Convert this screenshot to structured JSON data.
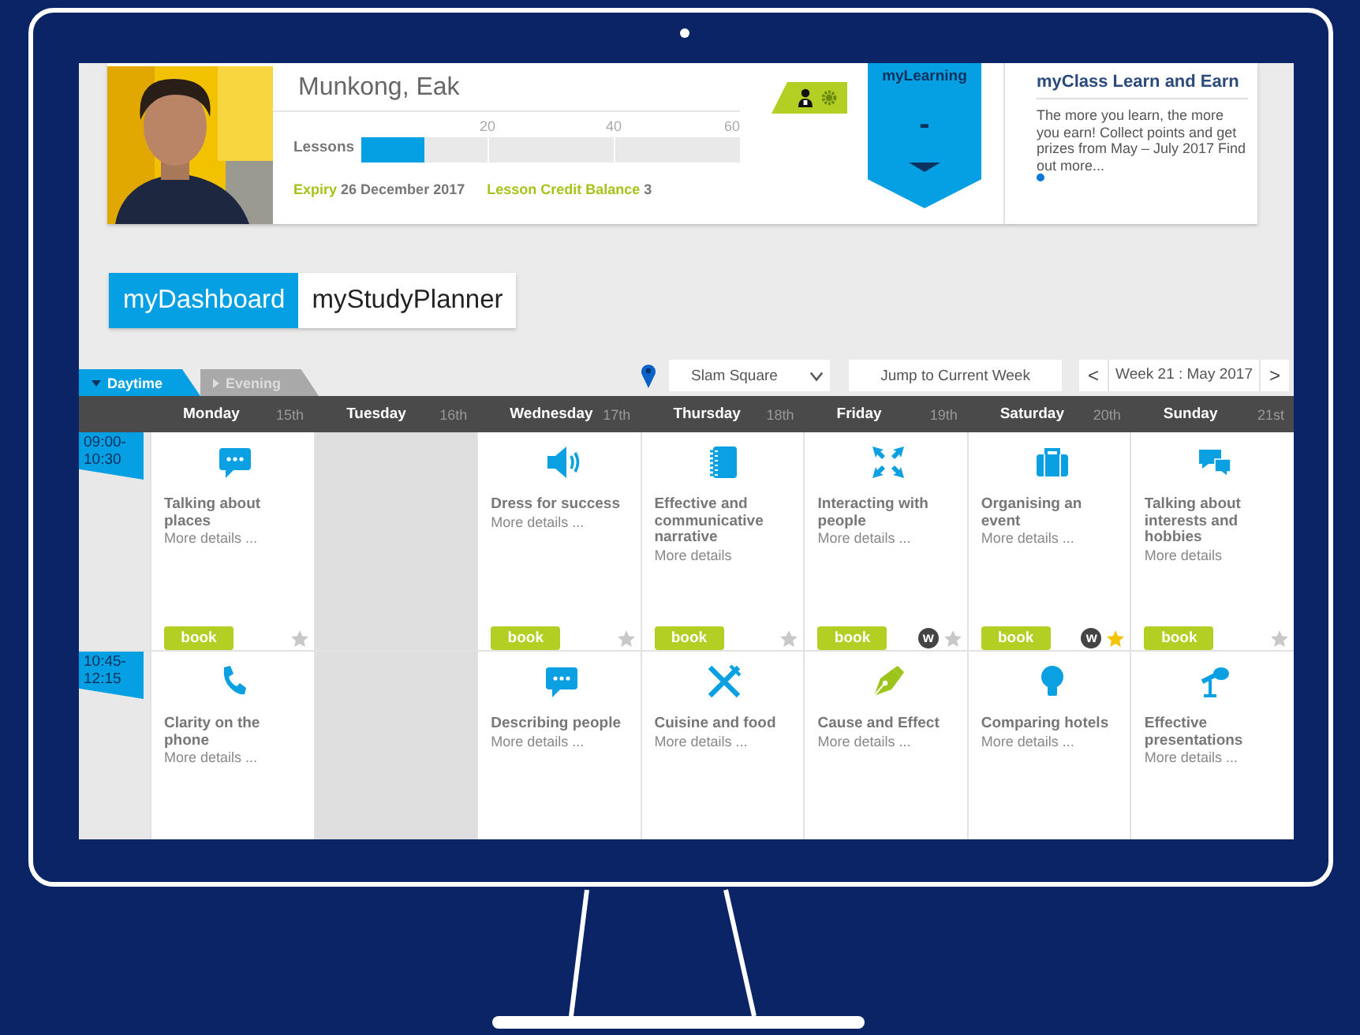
{
  "profile": {
    "name": "Munkong, Eak",
    "lessons_label": "Lessons",
    "ticks": [
      "20",
      "40",
      "60"
    ],
    "level": 0.167,
    "expiry_label": "Expiry",
    "expiry": "26 December 2017",
    "credit_label": "Lesson Credit Balance",
    "credit": "3"
  },
  "my_learning": {
    "title": "myLearning",
    "value": "-"
  },
  "my_class": {
    "title": "myClass Learn and Earn",
    "text": "The more you learn, the more you earn! Collect points and get prizes from May – July 2017 Find out more...",
    "pages": [
      {
        "selected": true
      }
    ]
  },
  "main_tabs": [
    {
      "label": "myDashboard",
      "selected": true
    },
    {
      "label": "myStudyPlanner",
      "selected": false
    }
  ],
  "time_tabs": [
    {
      "label": "Daytime",
      "selected": true
    },
    {
      "label": "Evening",
      "selected": false
    }
  ],
  "toolbar": {
    "location": "Slam Square",
    "jump_button": "Jump to Current Week",
    "prev": "<",
    "week": "Week 21 : May 2017",
    "next": ">"
  },
  "days": [
    {
      "name": "Monday",
      "date": "15th"
    },
    {
      "name": "Tuesday",
      "date": "16th"
    },
    {
      "name": "Wednesday",
      "date": "17th"
    },
    {
      "name": "Thursday",
      "date": "18th"
    },
    {
      "name": "Friday",
      "date": "19th"
    },
    {
      "name": "Saturday",
      "date": "20th"
    },
    {
      "name": "Sunday",
      "date": "21st"
    }
  ],
  "slots": [
    {
      "time": "09:00-10:30",
      "sessions": [
        {
          "kind": "lesson",
          "title": "Talking about places",
          "details": "More details ...",
          "book": "book",
          "starred": false
        },
        {
          "kind": "unavailable"
        },
        {
          "kind": "lesson",
          "title": "Dress for success",
          "details": "More details ...",
          "book": "book",
          "starred": false
        },
        {
          "kind": "lesson",
          "title": "Effective and communicative narrative",
          "details": "More details",
          "book": "book",
          "starred": false
        },
        {
          "kind": "lesson",
          "title": "Interacting with people",
          "details": "More details ...",
          "book": "book",
          "badge": "w",
          "starred": false
        },
        {
          "kind": "lesson",
          "title": "Organising an event",
          "details": "More details ...",
          "book": "book",
          "badge": "w",
          "starred": true
        },
        {
          "kind": "lesson",
          "title": "Talking about interests and hobbies",
          "details": "More details",
          "book": "book",
          "starred": false
        }
      ]
    },
    {
      "time": "10:45-12:15",
      "sessions": [
        {
          "kind": "lesson",
          "title": "Clarity on the phone",
          "details": "More details ..."
        },
        {
          "kind": "unavailable"
        },
        {
          "kind": "lesson",
          "title": "Describing people",
          "details": "More details ..."
        },
        {
          "kind": "lesson",
          "title": "Cuisine and food",
          "details": "More details ..."
        },
        {
          "kind": "lesson",
          "title": "Cause and Effect",
          "details": "More details ..."
        },
        {
          "kind": "lesson",
          "title": "Comparing hotels",
          "details": "More details ..."
        },
        {
          "kind": "lesson",
          "title": "Effective presentations",
          "details": "More details ..."
        }
      ]
    }
  ]
}
